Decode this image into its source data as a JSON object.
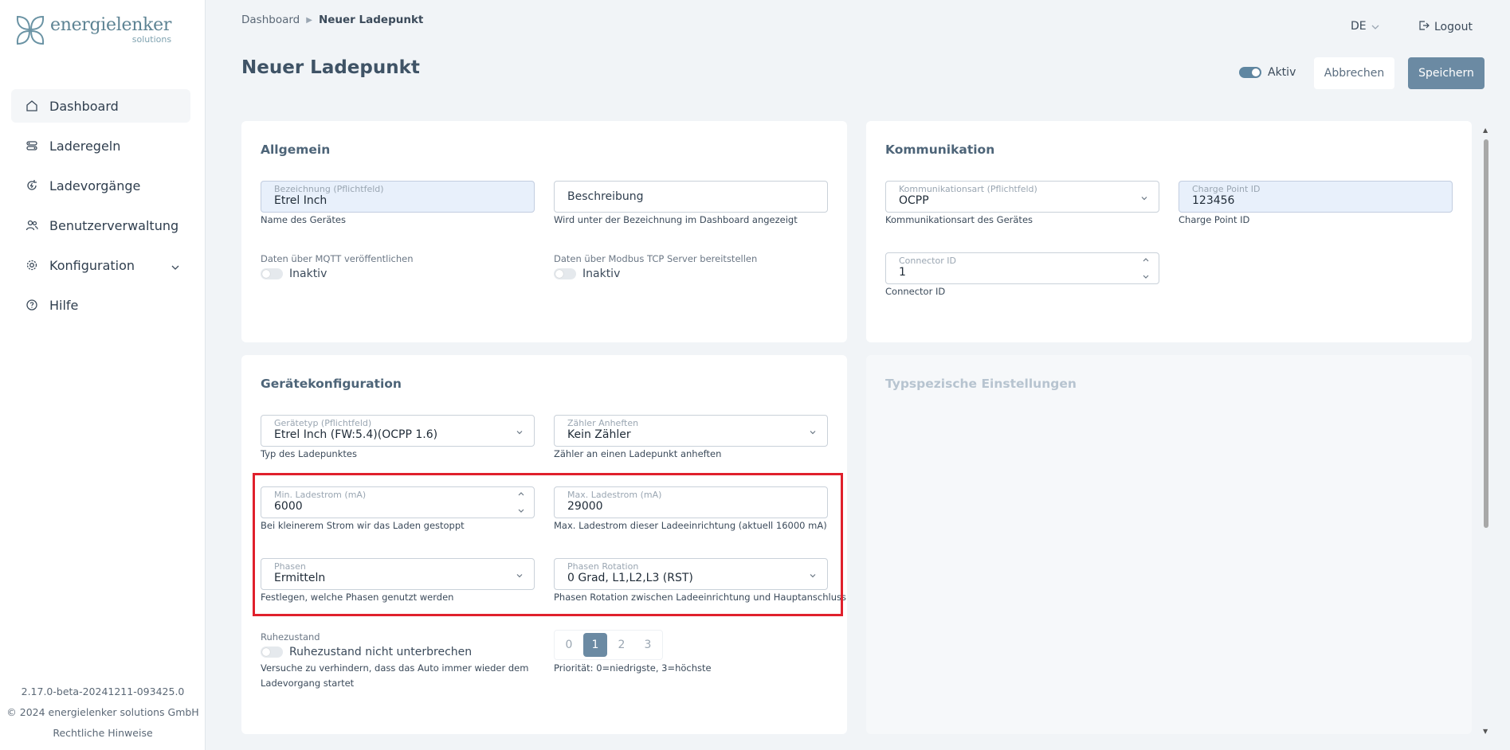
{
  "brand": {
    "name": "energielenker",
    "sub": "solutions"
  },
  "nav": [
    {
      "label": "Dashboard",
      "icon": "home-icon"
    },
    {
      "label": "Laderegeln",
      "icon": "rules-icon"
    },
    {
      "label": "Ladevorgänge",
      "icon": "charging-cycle-icon"
    },
    {
      "label": "Benutzerverwaltung",
      "icon": "users-icon"
    },
    {
      "label": "Konfiguration",
      "icon": "gear-icon"
    },
    {
      "label": "Hilfe",
      "icon": "help-icon"
    }
  ],
  "footer": {
    "version": "2.17.0-beta-20241211-093425.0",
    "copyright": "© 2024 energielenker solutions GmbH",
    "legal": "Rechtliche Hinweise"
  },
  "breadcrumb": {
    "root": "Dashboard",
    "current": "Neuer Ladepunkt"
  },
  "header": {
    "language": "DE",
    "logout": "Logout"
  },
  "page": {
    "title": "Neuer Ladepunkt",
    "active_label": "Aktiv",
    "cancel": "Abbrechen",
    "save": "Speichern"
  },
  "allgemein": {
    "title": "Allgemein",
    "bezeichnung_label": "Bezeichnung (Pflichtfeld)",
    "bezeichnung_value": "Etrel Inch",
    "bezeichnung_hint": "Name des Gerätes",
    "beschreibung_placeholder": "Beschreibung",
    "beschreibung_hint": "Wird unter der Bezeichnung im Dashboard angezeigt",
    "mqtt_label": "Daten über MQTT veröffentlichen",
    "mqtt_state": "Inaktiv",
    "modbus_label": "Daten über Modbus TCP Server bereitstellen",
    "modbus_state": "Inaktiv"
  },
  "kommunikation": {
    "title": "Kommunikation",
    "art_label": "Kommunikationsart (Pflichtfeld)",
    "art_value": "OCPP",
    "art_hint": "Kommunikationsart des Gerätes",
    "cpid_label": "Charge Point ID",
    "cpid_value": "123456",
    "cpid_hint": "Charge Point ID",
    "connector_label": "Connector ID",
    "connector_value": "1",
    "connector_hint": "Connector ID"
  },
  "geraet": {
    "title": "Gerätekonfiguration",
    "typ_label": "Gerätetyp (Pflichtfeld)",
    "typ_value": "Etrel Inch (FW:5.4)(OCPP 1.6)",
    "typ_hint": "Typ des Ladepunktes",
    "zaehler_label": "Zähler Anheften",
    "zaehler_value": "Kein Zähler",
    "zaehler_hint": "Zähler an einen Ladepunkt anheften",
    "min_label": "Min. Ladestrom (mA)",
    "min_value": "6000",
    "min_hint": "Bei kleinerem Strom wir das Laden gestoppt",
    "max_label": "Max. Ladestrom (mA)",
    "max_value": "29000",
    "max_hint": "Max. Ladestrom dieser Ladeeinrichtung (aktuell 16000 mA)",
    "phasen_label": "Phasen",
    "phasen_value": "Ermitteln",
    "phasen_hint": "Festlegen, welche Phasen genutzt werden",
    "rotation_label": "Phasen Rotation",
    "rotation_value": "0 Grad, L1,L2,L3 (RST)",
    "rotation_hint": "Phasen Rotation zwischen Ladeeinrichtung und Hauptanschluss",
    "ruhe_label": "Ruhezustand",
    "ruhe_switch": "Ruhezustand nicht unterbrechen",
    "ruhe_hint_1": "Versuche zu verhindern, dass das Auto immer wieder dem",
    "ruhe_hint_2": "Ladevorgang startet",
    "prio_options": [
      "0",
      "1",
      "2",
      "3"
    ],
    "prio_selected": "1",
    "prio_hint": "Priorität: 0=niedrigste, 3=höchste"
  },
  "typspezifisch": {
    "title": "Typspezische Einstellungen"
  },
  "colors": {
    "accent": "#6b8aa3",
    "highlight": "#e0202c",
    "background": "#f1f4f7"
  }
}
